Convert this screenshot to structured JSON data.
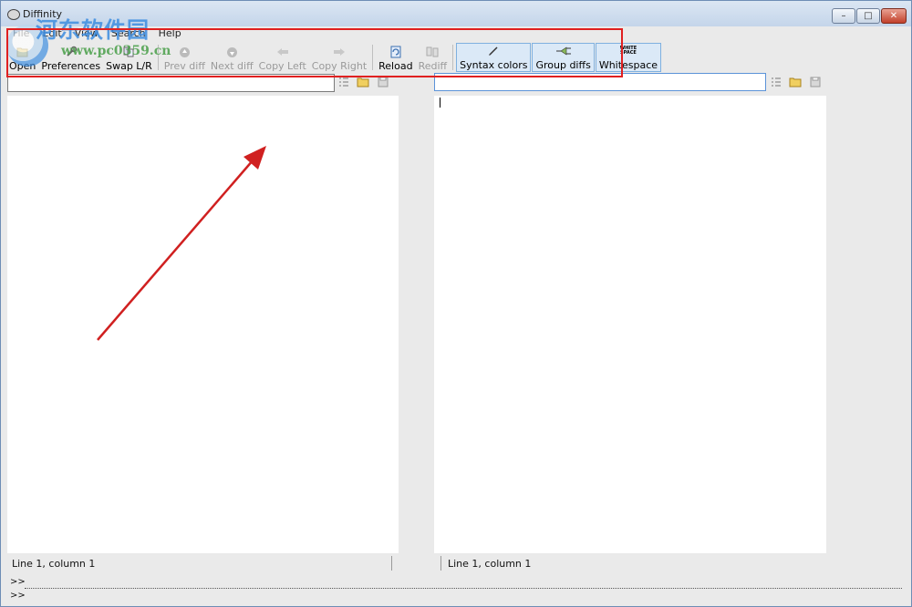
{
  "window": {
    "title": "Diffinity",
    "controls": {
      "minimize": "–",
      "maximize": "□",
      "close": "✕"
    }
  },
  "watermark": {
    "text": "河东软件园",
    "url": "www.pc0359.cn"
  },
  "menu": [
    {
      "label": "File"
    },
    {
      "label": "Edit"
    },
    {
      "label": "View"
    },
    {
      "label": "Search"
    },
    {
      "label": "Help"
    }
  ],
  "toolbar": {
    "open": "Open",
    "preferences": "Preferences",
    "swap": "Swap L/R",
    "prev_diff": "Prev diff",
    "next_diff": "Next diff",
    "copy_left": "Copy Left",
    "copy_right": "Copy Right",
    "reload": "Reload",
    "rediff": "Rediff",
    "syntax_colors": "Syntax colors",
    "group_diffs": "Group diffs",
    "whitespace": "Whitespace",
    "whitespace_icon_text": "WHITE SPACE"
  },
  "left": {
    "path_value": "",
    "status": "Line 1, column 1"
  },
  "right": {
    "path_value": "",
    "status": "Line 1, column 1"
  },
  "command": {
    "prompt1": ">>",
    "prompt2": ">>"
  },
  "colors": {
    "highlight": "#e02020",
    "arrow": "#d02020",
    "accent": "#5b93d8"
  }
}
